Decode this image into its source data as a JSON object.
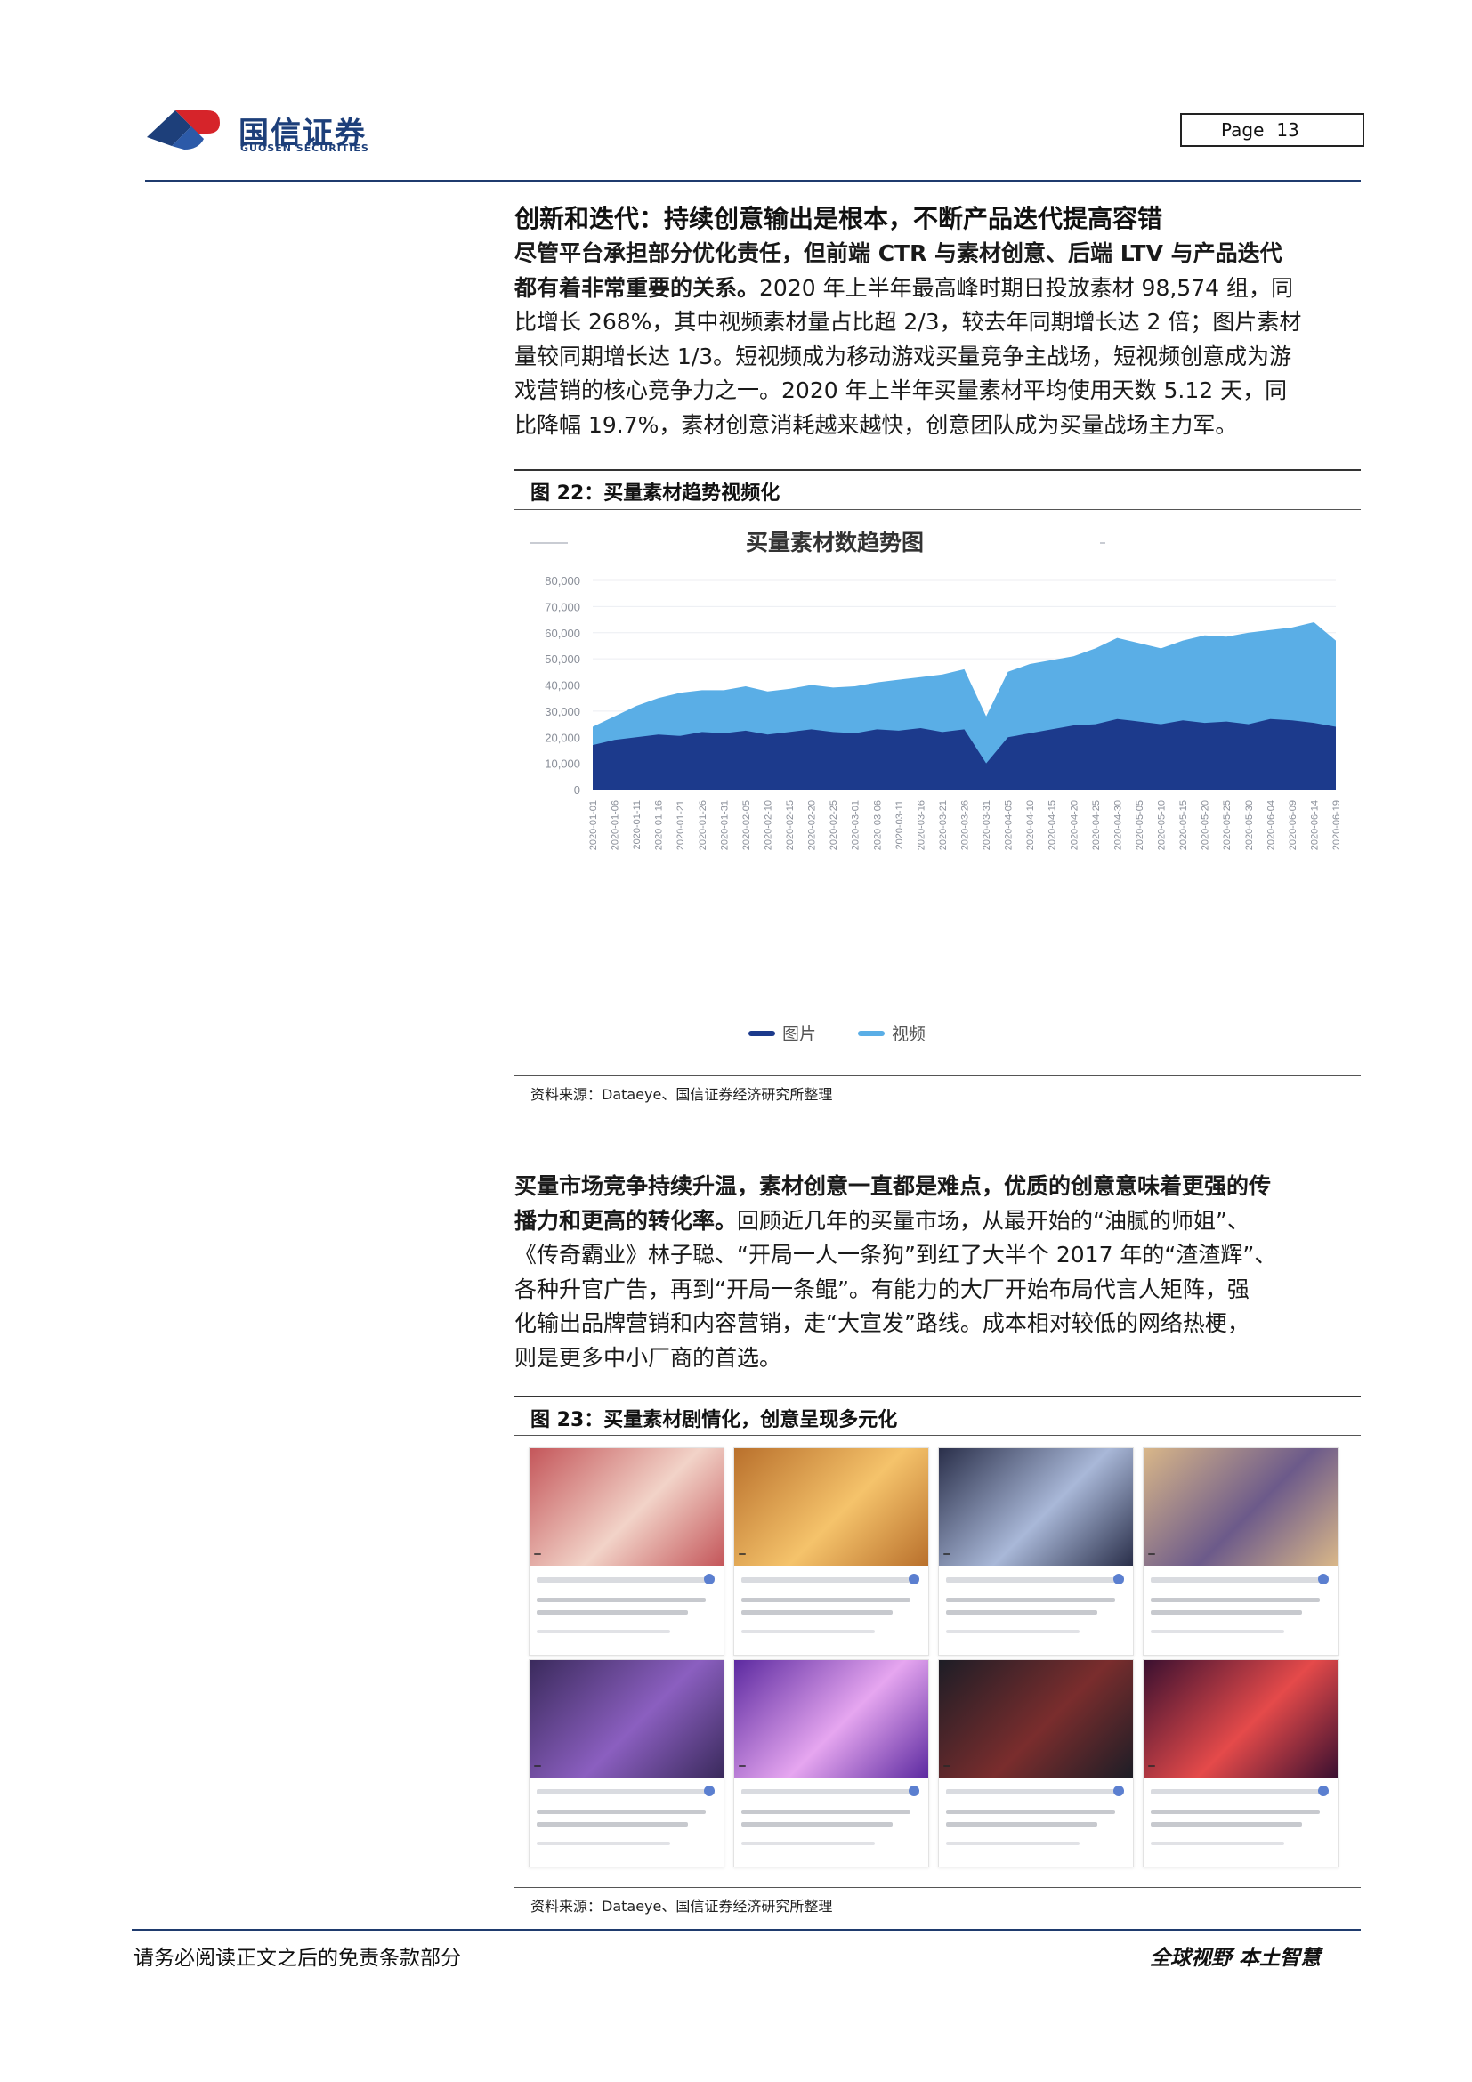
{
  "header": {
    "logo_cn": "国信证券",
    "logo_en": "GUOSEN SECURITIES",
    "page_label": "Page",
    "page_number": "13"
  },
  "section1": {
    "heading": "创新和迭代：持续创意输出是根本，不断产品迭代提高容错",
    "para_lines": [
      {
        "b": "尽管平台承担部分优化责任，但前端 CTR 与素材创意、后端 LTV 与产品迭代",
        "t": ""
      },
      {
        "b": "都有着非常重要的关系。",
        "t": "2020 年上半年最高峰时期日投放素材 98,574 组，同"
      },
      {
        "b": "",
        "t": "比增长 268%，其中视频素材量占比超 2/3，较去年同期增长达 2 倍；图片素材"
      },
      {
        "b": "",
        "t": "量较同期增长达 1/3。短视频成为移动游戏买量竞争主战场，短视频创意成为游"
      },
      {
        "b": "",
        "t": "戏营销的核心竞争力之一。2020 年上半年买量素材平均使用天数 5.12 天，同"
      },
      {
        "b": "",
        "t": "比降幅 19.7%，素材创意消耗越来越快，创意团队成为买量战场主力军。"
      }
    ]
  },
  "figure22": {
    "title": "图 22：买量素材趋势视频化",
    "source": "资料来源：Dataeye、国信证券经济研究所整理"
  },
  "chart_data": {
    "type": "area",
    "title": "买量素材数趋势图",
    "xlabel": "",
    "ylabel": "",
    "ylim": [
      0,
      80000
    ],
    "yticks": [
      "0",
      "10,000",
      "20,000",
      "30,000",
      "40,000",
      "50,000",
      "60,000",
      "70,000",
      "80,000"
    ],
    "x": [
      "2020-01-01",
      "2020-01-06",
      "2020-01-11",
      "2020-01-16",
      "2020-01-21",
      "2020-01-26",
      "2020-01-31",
      "2020-02-05",
      "2020-02-10",
      "2020-02-15",
      "2020-02-20",
      "2020-02-25",
      "2020-03-01",
      "2020-03-06",
      "2020-03-11",
      "2020-03-16",
      "2020-03-21",
      "2020-03-26",
      "2020-03-31",
      "2020-04-05",
      "2020-04-10",
      "2020-04-15",
      "2020-04-20",
      "2020-04-25",
      "2020-04-30",
      "2020-05-05",
      "2020-05-10",
      "2020-05-15",
      "2020-05-20",
      "2020-05-25",
      "2020-05-30",
      "2020-06-04",
      "2020-06-09",
      "2020-06-14",
      "2020-06-19"
    ],
    "series": [
      {
        "name": "图片",
        "color": "#1c3a8c",
        "values": [
          17000,
          19000,
          20000,
          21000,
          20500,
          22000,
          21500,
          22500,
          21000,
          22000,
          23000,
          22000,
          21500,
          23000,
          22500,
          23500,
          22000,
          23000,
          10000,
          20000,
          21500,
          23000,
          24500,
          25000,
          27000,
          26000,
          25000,
          26500,
          25500,
          26000,
          25000,
          27000,
          26500,
          25500,
          24000
        ]
      },
      {
        "name": "视频",
        "color": "#5aaee6",
        "values": [
          24000,
          28000,
          32000,
          35000,
          37000,
          38000,
          38000,
          39500,
          37500,
          38500,
          40000,
          39000,
          39500,
          41000,
          42000,
          43000,
          44000,
          46000,
          28000,
          45000,
          48000,
          49500,
          51000,
          54000,
          58000,
          56000,
          54000,
          57000,
          59000,
          58500,
          60000,
          61000,
          62000,
          64000,
          57000
        ]
      }
    ],
    "legend_position": "bottom"
  },
  "section2": {
    "para_lines": [
      {
        "b": "买量市场竞争持续升温，素材创意一直都是难点，优质的创意意味着更强的传",
        "t": ""
      },
      {
        "b": "播力和更高的转化率。",
        "t": "回顾近几年的买量市场，从最开始的“油腻的师姐”、"
      },
      {
        "b": "",
        "t": "《传奇霸业》林子聪、“开局一人一条狗”到红了大半个 2017 年的“渣渣辉”、"
      },
      {
        "b": "",
        "t": "各种升官广告，再到“开局一条鲲”。有能力的大厂开始布局代言人矩阵，强"
      },
      {
        "b": "",
        "t": "化输出品牌营销和内容营销，走“大宣发”路线。成本相对较低的网络热梗，"
      },
      {
        "b": "",
        "t": "则是更多中小厂商的首选。"
      }
    ]
  },
  "figure23": {
    "title": "图 23：买量素材剧情化，创意呈现多元化",
    "source": "资料来源：Dataeye、国信证券经济研究所整理",
    "thumb_colors": [
      [
        "#c4565a",
        "#f2d3c8"
      ],
      [
        "#b9702c",
        "#f5c36b"
      ],
      [
        "#2a2f4a",
        "#a9b8d8"
      ],
      [
        "#d9b789",
        "#6c5a8a"
      ],
      [
        "#3a2a5c",
        "#8b5fc0"
      ],
      [
        "#5c2aa0",
        "#e6a6f0"
      ],
      [
        "#1d1d26",
        "#7a2d2d"
      ],
      [
        "#3a1030",
        "#e54a4a"
      ]
    ]
  },
  "footer": {
    "left": "请务必阅读正文之后的免责条款部分",
    "right": "全球视野  本土智慧"
  }
}
